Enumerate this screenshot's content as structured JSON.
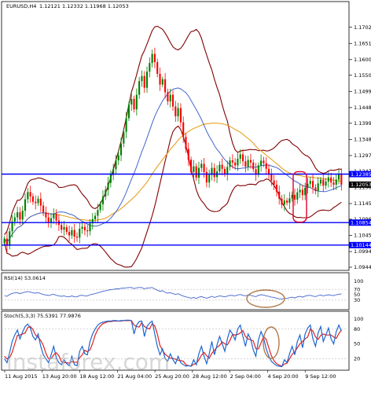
{
  "header": {
    "symbol": "EURUSD,H4",
    "ohlc": "1.12121 1.12332 1.11968 1.12053",
    "rsi": "RSI(14) 53.0614",
    "stoch": "Stoch(5,3,3) 75.5391 77.9876"
  },
  "watermark": "instaforex.com",
  "colors": {
    "bg": "#ffffff",
    "bull": "#008000",
    "bear": "#ff0000",
    "hline": "#0000ff",
    "ma_fast": "#4466cc",
    "ma_slow": "#e8a020",
    "bands": "#800000",
    "stoch_main": "#1e66d0",
    "stoch_signal": "#e02020",
    "rect": "#e0002a",
    "ellipse": "#b07a4a",
    "tag_bg": "#0000ff",
    "tag_dark": "#000000",
    "tag_fg": "#ffffff"
  },
  "chart_data": [
    {
      "type": "candlestick",
      "title": "EURUSD,H4",
      "ylim": [
        1.09445,
        1.17285
      ],
      "y_ticks": [
        1.1702,
        1.1651,
        1.16,
        1.15505,
        1.14995,
        1.14485,
        1.1399,
        1.1348,
        1.1297,
        1.12475,
        1.11965,
        1.11455,
        1.1096,
        1.1045,
        1.0994,
        1.09445
      ],
      "x_ticks": [
        "11 Aug 2015",
        "13 Aug 20:00",
        "18 Aug 12:00",
        "21 Aug 04:00",
        "25 Aug 20:00",
        "28 Aug 12:00",
        "2 Sep 04:00",
        "4 Sep 20:00",
        "9 Sep 12:00"
      ],
      "price_tags": [
        {
          "label": "1.12385",
          "value": 1.12385,
          "style": "blue"
        },
        {
          "label": "1.12053",
          "value": 1.12053,
          "style": "dark"
        },
        {
          "label": "1.10854",
          "value": 1.10854,
          "style": "blue"
        },
        {
          "label": "1.10144",
          "value": 1.10144,
          "style": "blue"
        }
      ],
      "horizontal_lines": [
        1.12385,
        1.10854,
        1.10144
      ],
      "close": [
        1.1035,
        1.1012,
        1.1058,
        1.1089,
        1.1102,
        1.1118,
        1.1095,
        1.1123,
        1.1159,
        1.1182,
        1.1168,
        1.1151,
        1.1147,
        1.1161,
        1.1139,
        1.1118,
        1.1102,
        1.1085,
        1.1099,
        1.1113,
        1.1092,
        1.1078,
        1.1063,
        1.1071,
        1.1056,
        1.1045,
        1.1062,
        1.1041,
        1.1038,
        1.1066,
        1.1072,
        1.1061,
        1.1058,
        1.1083,
        1.1096,
        1.1107,
        1.1125,
        1.1143,
        1.1168,
        1.1189,
        1.1211,
        1.1236,
        1.1254,
        1.1282,
        1.1298,
        1.1335,
        1.1372,
        1.1415,
        1.1458,
        1.1476,
        1.1443,
        1.1489,
        1.1532,
        1.1548,
        1.1511,
        1.1562,
        1.1589,
        1.1618,
        1.1592,
        1.1555,
        1.1521,
        1.1538,
        1.1497,
        1.1468,
        1.1489,
        1.1452,
        1.1421,
        1.1447,
        1.1402,
        1.1356,
        1.1318,
        1.1284,
        1.1245,
        1.1263,
        1.1227,
        1.1258,
        1.1271,
        1.1245,
        1.1212,
        1.1236,
        1.1258,
        1.1229,
        1.1247,
        1.1268,
        1.1255,
        1.1238,
        1.1261,
        1.1282,
        1.1275,
        1.1266,
        1.1287,
        1.1301,
        1.1279,
        1.1262,
        1.1283,
        1.1275,
        1.1254,
        1.1237,
        1.1266,
        1.1281,
        1.1273,
        1.1255,
        1.1239,
        1.1218,
        1.1205,
        1.1183,
        1.1161,
        1.1142,
        1.1155,
        1.1148,
        1.1162,
        1.1173,
        1.1158,
        1.1181,
        1.1189,
        1.1172,
        1.1195,
        1.1208,
        1.1217,
        1.1196,
        1.1185,
        1.1209,
        1.1221,
        1.1202,
        1.1215,
        1.1228,
        1.1212,
        1.1205,
        1.1221,
        1.1238,
        1.1205
      ]
    },
    {
      "type": "line",
      "title": "RSI(14) 53.0614",
      "ylim": [
        0,
        100
      ],
      "y_ticks": [
        100,
        70,
        50,
        30,
        0
      ],
      "values": [
        47,
        44,
        51,
        55,
        57,
        58,
        54,
        57,
        60,
        62,
        60,
        57,
        56,
        58,
        54,
        51,
        49,
        47,
        50,
        52,
        48,
        46,
        44,
        46,
        43,
        42,
        46,
        42,
        42,
        47,
        48,
        46,
        46,
        50,
        52,
        54,
        57,
        60,
        63,
        65,
        67,
        69,
        70,
        72,
        72,
        74,
        75,
        76,
        77,
        77,
        73,
        76,
        77,
        77,
        72,
        75,
        76,
        77,
        72,
        67,
        63,
        65,
        59,
        56,
        58,
        54,
        51,
        54,
        49,
        45,
        42,
        40,
        37,
        40,
        36,
        41,
        43,
        40,
        37,
        40,
        44,
        40,
        43,
        46,
        44,
        42,
        45,
        48,
        47,
        46,
        49,
        51,
        48,
        46,
        49,
        48,
        45,
        43,
        48,
        50,
        49,
        46,
        44,
        41,
        40,
        37,
        35,
        34,
        37,
        36,
        39,
        41,
        38,
        42,
        44,
        41,
        45,
        47,
        48,
        45,
        43,
        47,
        49,
        46,
        48,
        50,
        48,
        47,
        50,
        52,
        53
      ]
    },
    {
      "type": "line",
      "title": "Stoch(5,3,3) 75.5391 77.9876",
      "ylim": [
        0,
        100
      ],
      "y_ticks": [
        100,
        80,
        50,
        20,
        0
      ],
      "series": [
        {
          "name": "main",
          "values": [
            20,
            12,
            32,
            55,
            68,
            78,
            60,
            74,
            85,
            90,
            82,
            65,
            58,
            70,
            45,
            28,
            20,
            12,
            28,
            45,
            22,
            12,
            8,
            18,
            10,
            6,
            25,
            8,
            6,
            35,
            45,
            30,
            28,
            55,
            70,
            80,
            88,
            92,
            94,
            95,
            96,
            96,
            97,
            97,
            96,
            97,
            97,
            98,
            98,
            97,
            70,
            88,
            95,
            96,
            65,
            85,
            92,
            96,
            70,
            45,
            28,
            40,
            20,
            15,
            30,
            18,
            10,
            25,
            12,
            8,
            5,
            6,
            5,
            18,
            8,
            30,
            45,
            25,
            10,
            30,
            55,
            28,
            48,
            65,
            50,
            35,
            60,
            78,
            70,
            58,
            80,
            88,
            65,
            45,
            70,
            60,
            38,
            25,
            58,
            75,
            62,
            40,
            25,
            15,
            10,
            6,
            5,
            4,
            18,
            12,
            30,
            45,
            28,
            55,
            68,
            42,
            70,
            82,
            88,
            60,
            45,
            72,
            85,
            55,
            68,
            82,
            60,
            50,
            75,
            88,
            75.5
          ]
        },
        {
          "name": "signal",
          "values": [
            25,
            20,
            22,
            33,
            50,
            67,
            68,
            70,
            72,
            83,
            85,
            79,
            68,
            63,
            57,
            47,
            31,
            20,
            20,
            28,
            32,
            26,
            14,
            12,
            12,
            11,
            14,
            13,
            13,
            22,
            28,
            37,
            34,
            38,
            51,
            68,
            79,
            86,
            91,
            93,
            95,
            95,
            96,
            96,
            96,
            96,
            97,
            97,
            97,
            97,
            88,
            85,
            84,
            93,
            85,
            82,
            80,
            91,
            86,
            70,
            47,
            37,
            29,
            25,
            21,
            21,
            19,
            17,
            16,
            15,
            8,
            6,
            5,
            9,
            10,
            18,
            27,
            33,
            26,
            21,
            31,
            37,
            43,
            47,
            54,
            50,
            48,
            57,
            69,
            68,
            69,
            72,
            77,
            65,
            60,
            58,
            56,
            40,
            40,
            52,
            65,
            59,
            42,
            26,
            16,
            10,
            7,
            5,
            9,
            11,
            20,
            29,
            34,
            42,
            50,
            55,
            60,
            64,
            80,
            76,
            64,
            59,
            67,
            70,
            68,
            68,
            68,
            64,
            61,
            71,
            77.99
          ]
        }
      ]
    }
  ]
}
